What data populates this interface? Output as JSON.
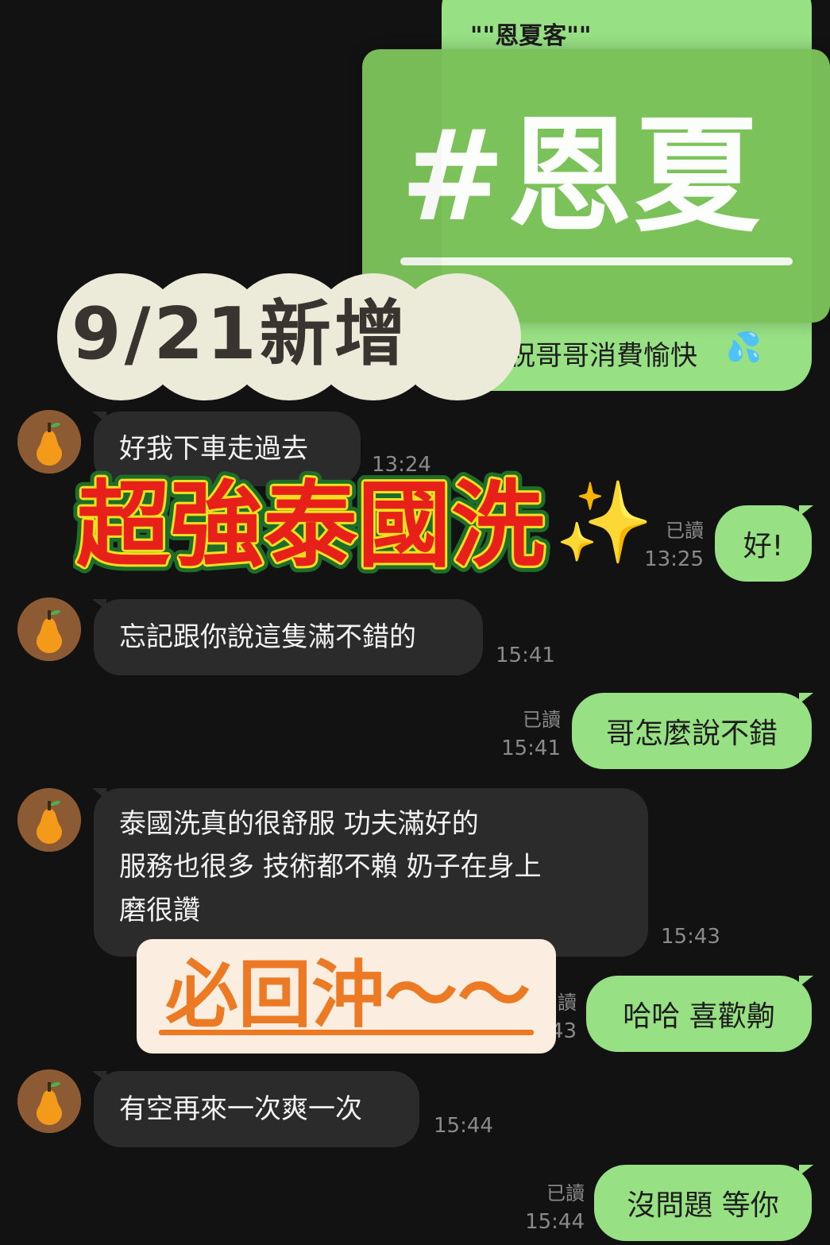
{
  "header_bubble": {
    "top_text": "\"\"恩夏客\"\"",
    "bottom_text": "祝哥哥消費愉快",
    "lips_emoji": "💋",
    "sweat_emoji": "💦"
  },
  "overlays": {
    "tag_title": "#恩夏",
    "date_badge": "9/21新增",
    "banner_red": "超強泰國洗",
    "sparkle_emoji": "✨",
    "banner_return": "必回沖～～"
  },
  "messages": [
    {
      "side": "in",
      "lines": [
        "好我下車走過去"
      ],
      "time": "13:24"
    },
    {
      "side": "out",
      "text": "好!",
      "read": "已讀",
      "time": "13:25"
    },
    {
      "side": "in",
      "lines": [
        "忘記跟你說這隻滿不錯的"
      ],
      "time": "15:41"
    },
    {
      "side": "out",
      "text": "哥怎麼說不錯",
      "read": "已讀",
      "time": "15:41"
    },
    {
      "side": "in",
      "lines": [
        "泰國洗真的很舒服  功夫滿好的",
        "服務也很多 技術都不賴 奶子在身上",
        "磨很讚"
      ],
      "time": "15:43"
    },
    {
      "side": "out",
      "text": "哈哈 喜歡齁",
      "read": "讀",
      "time": "43"
    },
    {
      "side": "in",
      "lines": [
        "有空再來一次爽一次"
      ],
      "time": "15:44"
    },
    {
      "side": "out",
      "text": "沒問題 等你",
      "read": "已讀",
      "time": "15:44"
    }
  ],
  "icons": {
    "avatar": "orange-pear-avatar-icon"
  },
  "colors": {
    "background": "#121212",
    "incoming_bubble": "#2b2b2b",
    "outgoing_bubble": "#97e083",
    "tag_panel": "#7cc25a",
    "red_banner_fill": "#e8201a",
    "red_banner_stroke": "#f5e020",
    "return_banner_text": "#ec7a24",
    "return_banner_bg": "#fbeee0"
  }
}
